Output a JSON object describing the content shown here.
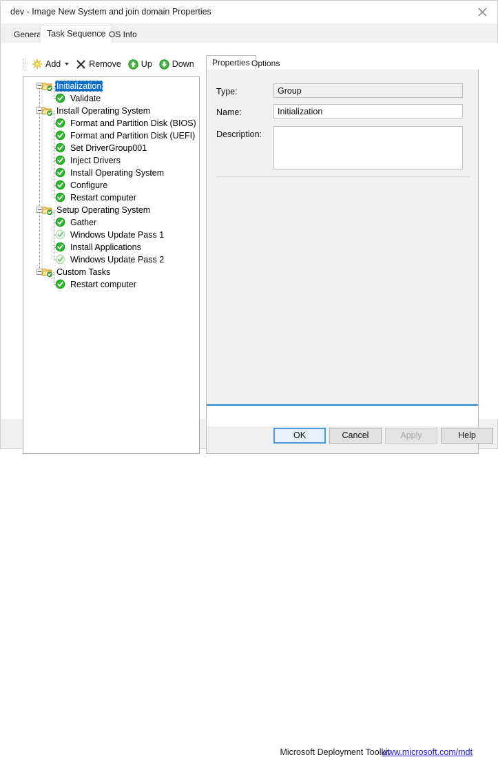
{
  "window": {
    "title": "dev - Image New System and join domain Properties",
    "close_icon": "close-icon"
  },
  "tabs": [
    {
      "label": "General",
      "active": false
    },
    {
      "label": "Task Sequence",
      "active": true
    },
    {
      "label": "OS Info",
      "active": false
    }
  ],
  "toolbar": {
    "add_label": "Add",
    "add_icon": "add-star-icon",
    "add_caret_icon": "chevron-down-icon",
    "remove_label": "Remove",
    "remove_icon": "remove-x-icon",
    "up_label": "Up",
    "up_icon": "arrow-up-circle-icon",
    "down_label": "Down",
    "down_icon": "arrow-down-circle-icon"
  },
  "tree": {
    "nodes": [
      {
        "label": "Initialization",
        "type": "group",
        "selected": true,
        "enabled": true
      },
      {
        "label": "Validate",
        "type": "step",
        "selected": false,
        "enabled": true
      },
      {
        "label": "Install Operating System",
        "type": "group",
        "selected": false,
        "enabled": true
      },
      {
        "label": "Format and Partition Disk (BIOS)",
        "type": "step",
        "selected": false,
        "enabled": true
      },
      {
        "label": "Format and Partition Disk (UEFI)",
        "type": "step",
        "selected": false,
        "enabled": true
      },
      {
        "label": "Set DriverGroup001",
        "type": "step",
        "selected": false,
        "enabled": true
      },
      {
        "label": "Inject Drivers",
        "type": "step",
        "selected": false,
        "enabled": true
      },
      {
        "label": "Install Operating System",
        "type": "step",
        "selected": false,
        "enabled": true
      },
      {
        "label": "Configure",
        "type": "step",
        "selected": false,
        "enabled": true
      },
      {
        "label": "Restart computer",
        "type": "step",
        "selected": false,
        "enabled": true
      },
      {
        "label": "Setup Operating System",
        "type": "group",
        "selected": false,
        "enabled": true
      },
      {
        "label": "Gather",
        "type": "step",
        "selected": false,
        "enabled": true
      },
      {
        "label": "Windows Update Pass 1",
        "type": "step",
        "selected": false,
        "enabled": false
      },
      {
        "label": "Install Applications",
        "type": "step",
        "selected": false,
        "enabled": true
      },
      {
        "label": "Windows Update Pass 2",
        "type": "step",
        "selected": false,
        "enabled": false
      },
      {
        "label": "Custom Tasks",
        "type": "group",
        "selected": false,
        "enabled": true
      },
      {
        "label": "Restart computer",
        "type": "step",
        "selected": false,
        "enabled": true
      }
    ]
  },
  "properties_pane": {
    "tabs": [
      {
        "label": "Properties",
        "active": true
      },
      {
        "label": "Options",
        "active": false
      }
    ],
    "type_label": "Type:",
    "type_value": "Group",
    "name_label": "Name:",
    "name_value": "Initialization",
    "description_label": "Description:",
    "description_value": ""
  },
  "branding": {
    "text": "Microsoft Deployment Toolkit",
    "link": "www.microsoft.com/mdt"
  },
  "buttons": {
    "ok": "OK",
    "cancel": "Cancel",
    "apply": "Apply",
    "help": "Help"
  },
  "colors": {
    "selection_blue": "#0a6cc4",
    "accent_rule": "#2a7fc9",
    "link_blue": "#2020d0",
    "enabled_green": "#2eb82e",
    "disabled_green": "#a8dcaa",
    "folder_yellow": "#f3c23c"
  }
}
